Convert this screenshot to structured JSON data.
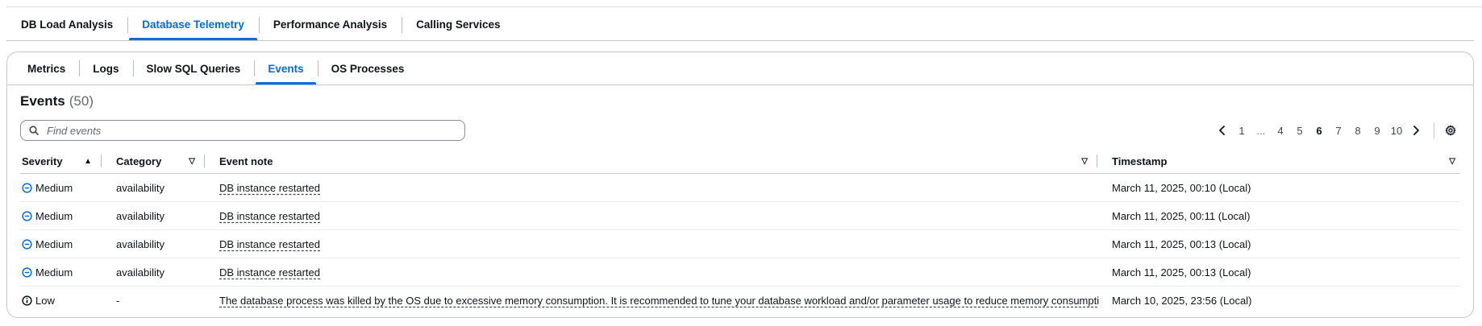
{
  "top_tabs": [
    "DB Load Analysis",
    "Database Telemetry",
    "Performance Analysis",
    "Calling Services"
  ],
  "top_active": "Database Telemetry",
  "sub_tabs": [
    "Metrics",
    "Logs",
    "Slow SQL Queries",
    "Events",
    "OS Processes"
  ],
  "sub_active": "Events",
  "events": {
    "title": "Events",
    "count": "(50)",
    "search_placeholder": "Find events",
    "pagination": {
      "prev_icon": "chevron-left-icon",
      "pages": [
        "1",
        "...",
        "4",
        "5",
        "6",
        "7",
        "8",
        "9",
        "10"
      ],
      "current": "6",
      "next_icon": "chevron-right-icon"
    },
    "settings_icon": "gear-icon",
    "columns": {
      "severity": "Severity",
      "category": "Category",
      "note": "Event note",
      "timestamp": "Timestamp"
    },
    "rows": [
      {
        "severity": "Medium",
        "severity_icon": "minus-circle-icon",
        "category": "availability",
        "note": "DB instance restarted",
        "timestamp": "March 11, 2025, 00:10 (Local)"
      },
      {
        "severity": "Medium",
        "severity_icon": "minus-circle-icon",
        "category": "availability",
        "note": "DB instance restarted",
        "timestamp": "March 11, 2025, 00:11 (Local)"
      },
      {
        "severity": "Medium",
        "severity_icon": "minus-circle-icon",
        "category": "availability",
        "note": "DB instance restarted",
        "timestamp": "March 11, 2025, 00:13 (Local)"
      },
      {
        "severity": "Medium",
        "severity_icon": "minus-circle-icon",
        "category": "availability",
        "note": "DB instance restarted",
        "timestamp": "March 11, 2025, 00:13 (Local)"
      },
      {
        "severity": "Low",
        "severity_icon": "info-circle-icon",
        "category": "-",
        "note": "The database process was killed by the OS due to excessive memory consumption. It is recommended to tune your database workload and/or parameter usage to reduce memory consumption.",
        "timestamp": "March 10, 2025, 23:56 (Local)"
      }
    ]
  },
  "colors": {
    "accent": "#006ce0",
    "medium_icon": "#006ce0",
    "low_icon": "#0f141a"
  }
}
